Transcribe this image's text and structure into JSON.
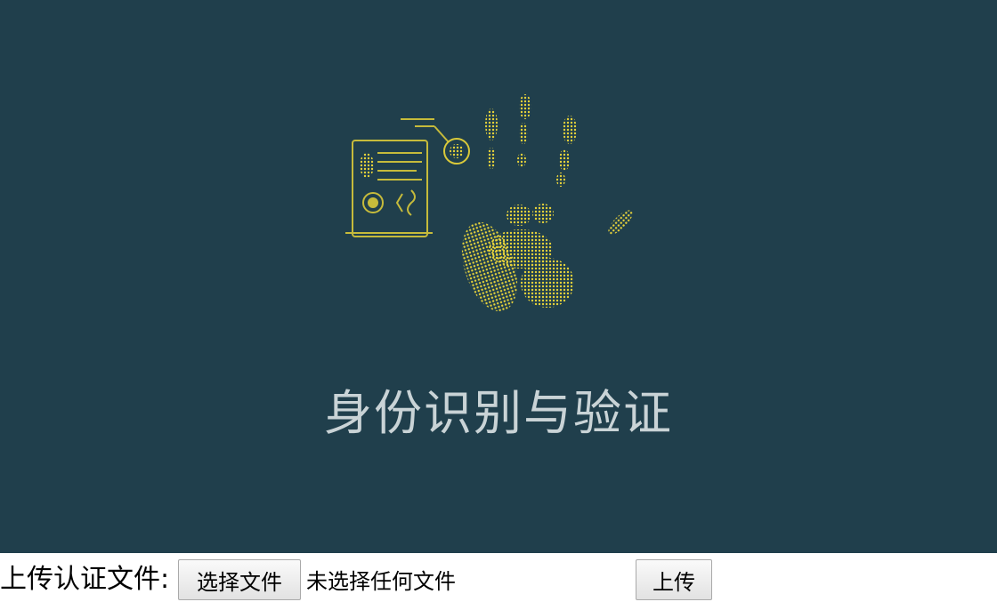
{
  "banner": {
    "title": "身份识别与验证",
    "illustration": "handprint-scan-icon",
    "colors": {
      "background": "#203f4c",
      "accent": "#e6d23a",
      "title": "#c9d3d6"
    }
  },
  "upload": {
    "label": "上传认证文件:",
    "choose_button": "选择文件",
    "file_status": "未选择任何文件",
    "submit_button": "上传"
  }
}
